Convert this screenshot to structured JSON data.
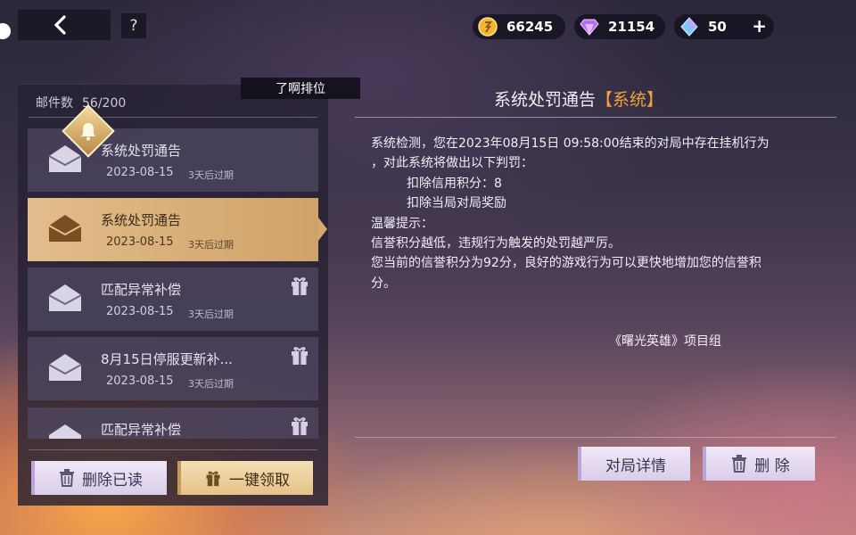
{
  "topbar": {
    "help": "?",
    "currencies": [
      {
        "icon": "gold-coin-icon",
        "value": "66245"
      },
      {
        "icon": "purple-diamond-icon",
        "value": "21154"
      },
      {
        "icon": "blue-crystal-icon",
        "value": "50",
        "plus": "+"
      }
    ]
  },
  "mail": {
    "count_label": "邮件数",
    "count_value": "56/200",
    "items": [
      {
        "title": "系统处罚通告",
        "date": "2023-08-15",
        "expire": "3天后过期",
        "gift": false,
        "active": false
      },
      {
        "title": "系统处罚通告",
        "date": "2023-08-15",
        "expire": "3天后过期",
        "gift": false,
        "active": true
      },
      {
        "title": "匹配异常补偿",
        "date": "2023-08-15",
        "expire": "3天后过期",
        "gift": true,
        "active": false
      },
      {
        "title": "8月15日停服更新补...",
        "date": "2023-08-15",
        "expire": "3天后过期",
        "gift": true,
        "active": false
      },
      {
        "title": "匹配异常补偿",
        "gift": true,
        "active": false
      }
    ],
    "delete_read_label": "删除已读",
    "claim_all_label": "一键领取"
  },
  "detail": {
    "tag": "了啊排位",
    "title": "系统处罚通告",
    "title_tag": "【系统】",
    "lines": [
      "系统检测，您在2023年08月15日 09:58:00结束的对局中存在挂机行为",
      "，对此系统将做出以下判罚：",
      "扣除信用积分：8",
      "扣除当局对局奖励",
      "温馨提示：",
      "信誉积分越低，违规行为触发的处罚越严厉。",
      "您当前的信誉积分为92分，良好的游戏行为可以更快地增加您的信誉积",
      "分。"
    ],
    "signature": "《曙光英雄》项目组",
    "match_detail_label": "对局详情",
    "delete_label": "删 除"
  },
  "colors": {
    "accent_gold": "#d6a86d",
    "title_tag": "#f0a23c",
    "button_lavender": "#e6def0"
  }
}
